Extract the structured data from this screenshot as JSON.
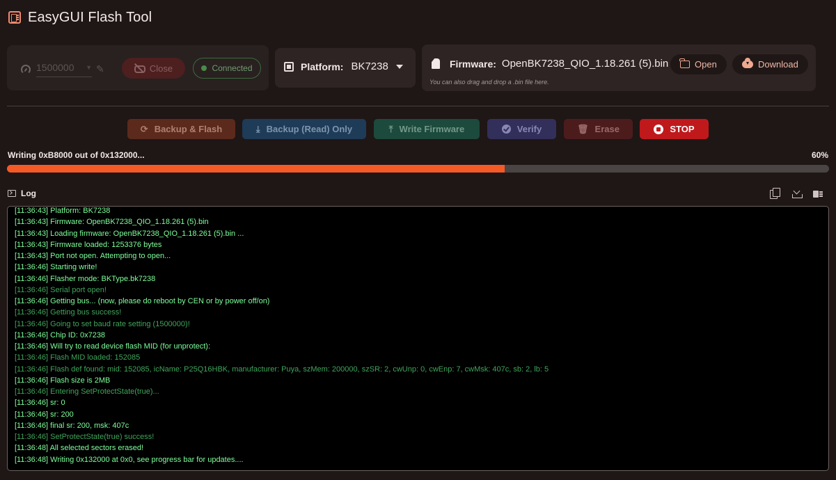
{
  "app": {
    "title": "EasyGUI Flash Tool"
  },
  "connection": {
    "baud": "1500000",
    "close_label": "Close",
    "status_label": "Connected"
  },
  "platform": {
    "label": "Platform:",
    "value": "BK7238"
  },
  "firmware": {
    "label": "Firmware:",
    "value": "OpenBK7238_QIO_1.18.261 (5).bin",
    "hint": "You can also drag and drop a .bin file here.",
    "open_label": "Open",
    "download_label": "Download"
  },
  "actions": {
    "backup_flash": "Backup & Flash",
    "backup_read": "Backup (Read) Only",
    "write_firmware": "Write Firmware",
    "verify": "Verify",
    "erase": "Erase",
    "stop": "STOP"
  },
  "progress": {
    "text": "Writing 0xB8000 out of 0x132000...",
    "percent_label": "60%",
    "fraction": 0.605
  },
  "log": {
    "title": "Log",
    "lines": [
      {
        "text": "[11:36:43] Platform: BK7238",
        "style": "bright"
      },
      {
        "text": "[11:36:43] Firmware: OpenBK7238_QIO_1.18.261 (5).bin",
        "style": "bright"
      },
      {
        "text": "[11:36:43] Loading firmware: OpenBK7238_QIO_1.18.261 (5).bin ...",
        "style": "bright"
      },
      {
        "text": "[11:36:43] Firmware loaded: 1253376 bytes",
        "style": "bright"
      },
      {
        "text": "[11:36:43] Port not open. Attempting to open...",
        "style": "bright"
      },
      {
        "text": "[11:36:46] Starting write!",
        "style": "bright"
      },
      {
        "text": "[11:36:46] Flasher mode: BKType.bk7238",
        "style": "bright"
      },
      {
        "text": "[11:36:46] Serial port open!",
        "style": "dim"
      },
      {
        "text": "[11:36:46] Getting bus... (now, please do reboot by CEN or by power off/on)",
        "style": "bright"
      },
      {
        "text": "[11:36:46] Getting bus success!",
        "style": "dim"
      },
      {
        "text": "[11:36:46] Going to set baud rate setting (1500000)!",
        "style": "dim"
      },
      {
        "text": "[11:36:46] Chip ID: 0x7238",
        "style": "bright"
      },
      {
        "text": "[11:36:46] Will try to read device flash MID (for unprotect):",
        "style": "bright"
      },
      {
        "text": "[11:36:46] Flash MID loaded: 152085",
        "style": "dim"
      },
      {
        "text": "[11:36:46] Flash def found: mid: 152085, icName: P25Q16HBK, manufacturer: Puya, szMem: 200000, szSR: 2, cwUnp: 0, cwEnp: 7, cwMsk: 407c, sb: 2, lb: 5",
        "style": "dim"
      },
      {
        "text": "[11:36:46] Flash size is 2MB",
        "style": "bright"
      },
      {
        "text": "[11:36:46] Entering SetProtectState(true)...",
        "style": "dim"
      },
      {
        "text": "[11:36:46] sr: 0",
        "style": "bright"
      },
      {
        "text": "[11:36:46] sr: 200",
        "style": "bright"
      },
      {
        "text": "[11:36:46] final sr: 200, msk: 407c",
        "style": "bright"
      },
      {
        "text": "[11:36:46] SetProtectState(true) success!",
        "style": "dim"
      },
      {
        "text": "[11:36:48] All selected sectors erased!",
        "style": "bright"
      },
      {
        "text": "[11:36:48] Writing 0x132000 at 0x0, see progress bar for updates....",
        "style": "bright"
      }
    ]
  }
}
